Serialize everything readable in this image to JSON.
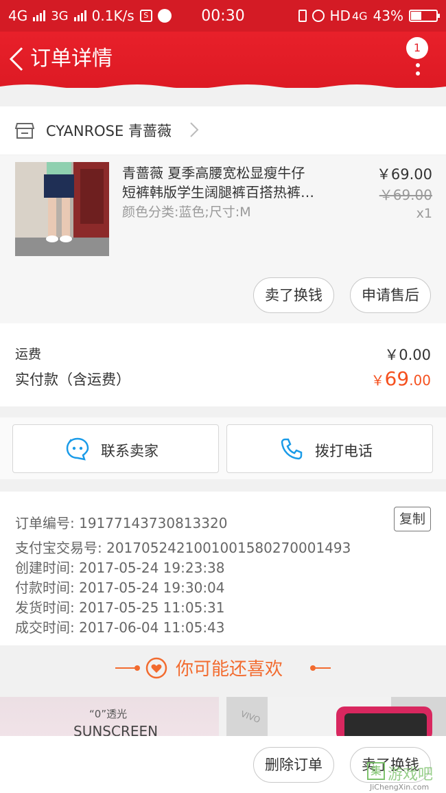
{
  "status_bar": {
    "net1": "4G",
    "net2": "3G",
    "speed": "0.1K/s",
    "time": "00:30",
    "hd": "HD",
    "lte": "4G",
    "battery": "43%",
    "battery_level": 0.43
  },
  "nav": {
    "title": "订单详情",
    "badge_count": "1"
  },
  "shop": {
    "name": "CYANROSE 青蔷薇"
  },
  "product": {
    "title_line1": "青蔷薇 夏季高腰宽松显瘦牛仔",
    "title_line2": "短裤韩版学生阔腿裤百搭热裤…",
    "sku": "颜色分类:蓝色;尺寸:M",
    "price": "￥69.00",
    "original_price": "￥69.00",
    "quantity": "x1",
    "sell_button": "卖了换钱",
    "after_sale_button": "申请售后"
  },
  "fees": {
    "shipping_label": "运费",
    "shipping_value": "￥0.00",
    "paid_label": "实付款（含运费）",
    "paid_currency": "￥",
    "paid_int": "69",
    "paid_dec": ".00"
  },
  "contact": {
    "seller_label": "联系卖家",
    "phone_label": "拨打电话"
  },
  "order_info": {
    "order_no": "订单编号: 19177143730813320",
    "copy_label": "复制",
    "alipay_no": "支付宝交易号: 2017052421001001580270001493",
    "created": "创建时间: 2017-05-24 19:23:38",
    "paid": "付款时间: 2017-05-24 19:30:04",
    "shipped": "发货时间: 2017-05-25 11:05:31",
    "completed": "成交时间: 2017-06-04 11:05:43"
  },
  "recommend": {
    "title": "你可能还喜欢",
    "item1_line1": "“0”透光",
    "item1_line2": "SUNSCREEN"
  },
  "bottom_bar": {
    "delete_button": "删除订单",
    "sell_button": "卖了换钱"
  },
  "watermark": {
    "badge": "集",
    "name": "游戏吧",
    "url": "JiChengXin.com"
  },
  "colors": {
    "header_red": "#e4222b",
    "price_orange": "#f5511f",
    "recommend_orange": "#f26b2f",
    "icon_blue": "#1a9be8"
  }
}
